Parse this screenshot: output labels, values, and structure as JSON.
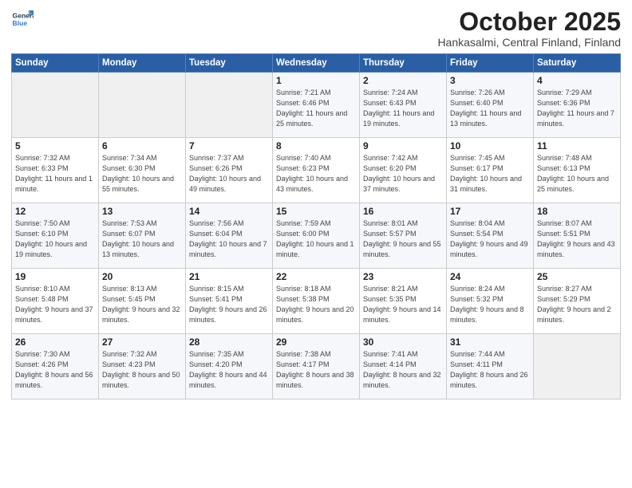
{
  "header": {
    "title": "October 2025",
    "location": "Hankasalmi, Central Finland, Finland"
  },
  "weekdays": [
    "Sunday",
    "Monday",
    "Tuesday",
    "Wednesday",
    "Thursday",
    "Friday",
    "Saturday"
  ],
  "weeks": [
    [
      {
        "day": "",
        "sunrise": "",
        "sunset": "",
        "daylight": ""
      },
      {
        "day": "",
        "sunrise": "",
        "sunset": "",
        "daylight": ""
      },
      {
        "day": "",
        "sunrise": "",
        "sunset": "",
        "daylight": ""
      },
      {
        "day": "1",
        "sunrise": "Sunrise: 7:21 AM",
        "sunset": "Sunset: 6:46 PM",
        "daylight": "Daylight: 11 hours and 25 minutes."
      },
      {
        "day": "2",
        "sunrise": "Sunrise: 7:24 AM",
        "sunset": "Sunset: 6:43 PM",
        "daylight": "Daylight: 11 hours and 19 minutes."
      },
      {
        "day": "3",
        "sunrise": "Sunrise: 7:26 AM",
        "sunset": "Sunset: 6:40 PM",
        "daylight": "Daylight: 11 hours and 13 minutes."
      },
      {
        "day": "4",
        "sunrise": "Sunrise: 7:29 AM",
        "sunset": "Sunset: 6:36 PM",
        "daylight": "Daylight: 11 hours and 7 minutes."
      }
    ],
    [
      {
        "day": "5",
        "sunrise": "Sunrise: 7:32 AM",
        "sunset": "Sunset: 6:33 PM",
        "daylight": "Daylight: 11 hours and 1 minute."
      },
      {
        "day": "6",
        "sunrise": "Sunrise: 7:34 AM",
        "sunset": "Sunset: 6:30 PM",
        "daylight": "Daylight: 10 hours and 55 minutes."
      },
      {
        "day": "7",
        "sunrise": "Sunrise: 7:37 AM",
        "sunset": "Sunset: 6:26 PM",
        "daylight": "Daylight: 10 hours and 49 minutes."
      },
      {
        "day": "8",
        "sunrise": "Sunrise: 7:40 AM",
        "sunset": "Sunset: 6:23 PM",
        "daylight": "Daylight: 10 hours and 43 minutes."
      },
      {
        "day": "9",
        "sunrise": "Sunrise: 7:42 AM",
        "sunset": "Sunset: 6:20 PM",
        "daylight": "Daylight: 10 hours and 37 minutes."
      },
      {
        "day": "10",
        "sunrise": "Sunrise: 7:45 AM",
        "sunset": "Sunset: 6:17 PM",
        "daylight": "Daylight: 10 hours and 31 minutes."
      },
      {
        "day": "11",
        "sunrise": "Sunrise: 7:48 AM",
        "sunset": "Sunset: 6:13 PM",
        "daylight": "Daylight: 10 hours and 25 minutes."
      }
    ],
    [
      {
        "day": "12",
        "sunrise": "Sunrise: 7:50 AM",
        "sunset": "Sunset: 6:10 PM",
        "daylight": "Daylight: 10 hours and 19 minutes."
      },
      {
        "day": "13",
        "sunrise": "Sunrise: 7:53 AM",
        "sunset": "Sunset: 6:07 PM",
        "daylight": "Daylight: 10 hours and 13 minutes."
      },
      {
        "day": "14",
        "sunrise": "Sunrise: 7:56 AM",
        "sunset": "Sunset: 6:04 PM",
        "daylight": "Daylight: 10 hours and 7 minutes."
      },
      {
        "day": "15",
        "sunrise": "Sunrise: 7:59 AM",
        "sunset": "Sunset: 6:00 PM",
        "daylight": "Daylight: 10 hours and 1 minute."
      },
      {
        "day": "16",
        "sunrise": "Sunrise: 8:01 AM",
        "sunset": "Sunset: 5:57 PM",
        "daylight": "Daylight: 9 hours and 55 minutes."
      },
      {
        "day": "17",
        "sunrise": "Sunrise: 8:04 AM",
        "sunset": "Sunset: 5:54 PM",
        "daylight": "Daylight: 9 hours and 49 minutes."
      },
      {
        "day": "18",
        "sunrise": "Sunrise: 8:07 AM",
        "sunset": "Sunset: 5:51 PM",
        "daylight": "Daylight: 9 hours and 43 minutes."
      }
    ],
    [
      {
        "day": "19",
        "sunrise": "Sunrise: 8:10 AM",
        "sunset": "Sunset: 5:48 PM",
        "daylight": "Daylight: 9 hours and 37 minutes."
      },
      {
        "day": "20",
        "sunrise": "Sunrise: 8:13 AM",
        "sunset": "Sunset: 5:45 PM",
        "daylight": "Daylight: 9 hours and 32 minutes."
      },
      {
        "day": "21",
        "sunrise": "Sunrise: 8:15 AM",
        "sunset": "Sunset: 5:41 PM",
        "daylight": "Daylight: 9 hours and 26 minutes."
      },
      {
        "day": "22",
        "sunrise": "Sunrise: 8:18 AM",
        "sunset": "Sunset: 5:38 PM",
        "daylight": "Daylight: 9 hours and 20 minutes."
      },
      {
        "day": "23",
        "sunrise": "Sunrise: 8:21 AM",
        "sunset": "Sunset: 5:35 PM",
        "daylight": "Daylight: 9 hours and 14 minutes."
      },
      {
        "day": "24",
        "sunrise": "Sunrise: 8:24 AM",
        "sunset": "Sunset: 5:32 PM",
        "daylight": "Daylight: 9 hours and 8 minutes."
      },
      {
        "day": "25",
        "sunrise": "Sunrise: 8:27 AM",
        "sunset": "Sunset: 5:29 PM",
        "daylight": "Daylight: 9 hours and 2 minutes."
      }
    ],
    [
      {
        "day": "26",
        "sunrise": "Sunrise: 7:30 AM",
        "sunset": "Sunset: 4:26 PM",
        "daylight": "Daylight: 8 hours and 56 minutes."
      },
      {
        "day": "27",
        "sunrise": "Sunrise: 7:32 AM",
        "sunset": "Sunset: 4:23 PM",
        "daylight": "Daylight: 8 hours and 50 minutes."
      },
      {
        "day": "28",
        "sunrise": "Sunrise: 7:35 AM",
        "sunset": "Sunset: 4:20 PM",
        "daylight": "Daylight: 8 hours and 44 minutes."
      },
      {
        "day": "29",
        "sunrise": "Sunrise: 7:38 AM",
        "sunset": "Sunset: 4:17 PM",
        "daylight": "Daylight: 8 hours and 38 minutes."
      },
      {
        "day": "30",
        "sunrise": "Sunrise: 7:41 AM",
        "sunset": "Sunset: 4:14 PM",
        "daylight": "Daylight: 8 hours and 32 minutes."
      },
      {
        "day": "31",
        "sunrise": "Sunrise: 7:44 AM",
        "sunset": "Sunset: 4:11 PM",
        "daylight": "Daylight: 8 hours and 26 minutes."
      },
      {
        "day": "",
        "sunrise": "",
        "sunset": "",
        "daylight": ""
      }
    ]
  ]
}
